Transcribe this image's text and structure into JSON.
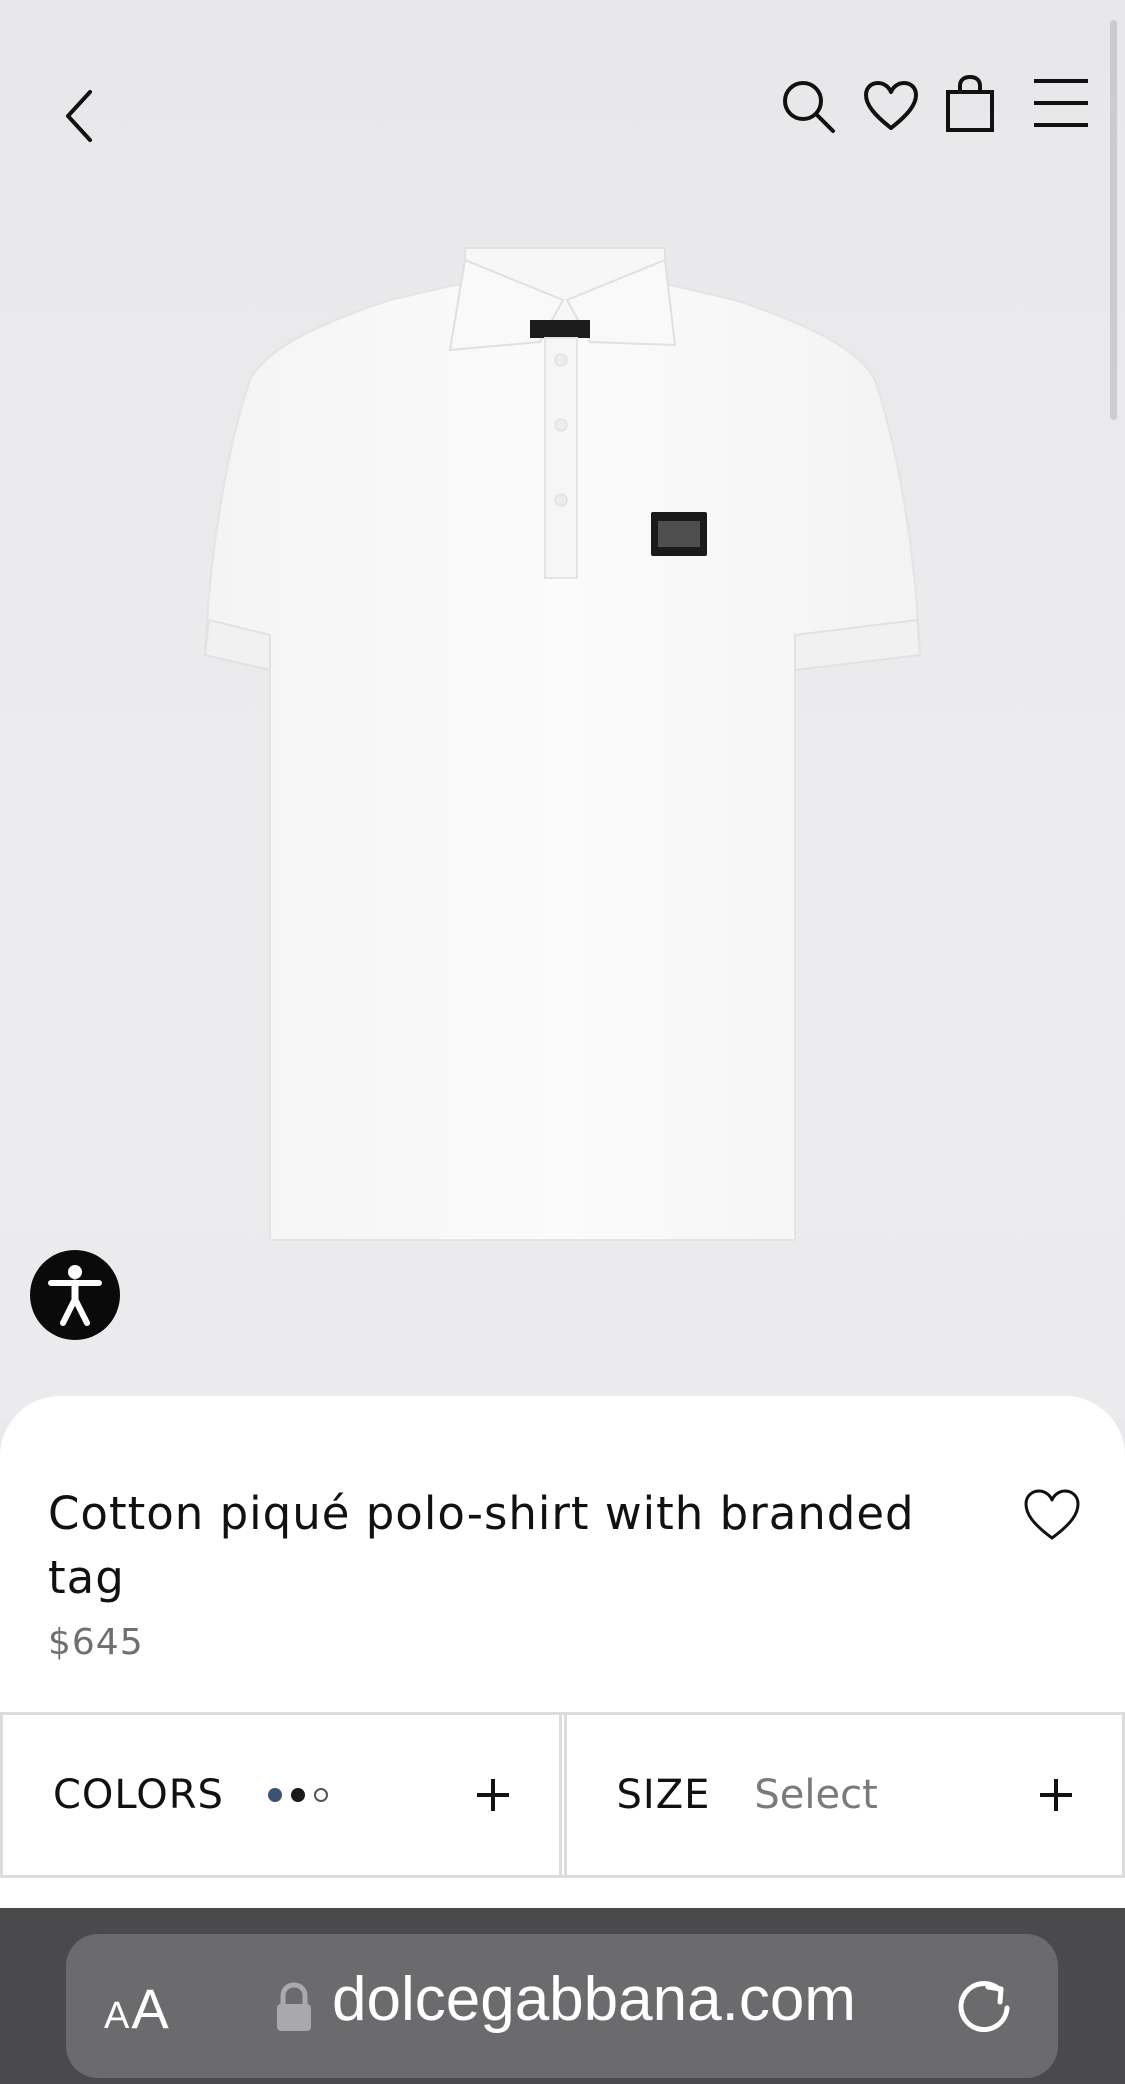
{
  "header": {
    "icons": [
      "chevron-left-icon",
      "search-icon",
      "heart-icon",
      "shopping-bag-icon",
      "hamburger-menu-icon"
    ]
  },
  "accessibility": {
    "icon": "accessibility-icon",
    "background": "#0a0a0a"
  },
  "product": {
    "title": "Cotton piqué polo-shirt with branded tag",
    "price": "$645",
    "image_icon": "white-polo-shirt-image",
    "wishlist_icon": "heart-outline-icon"
  },
  "options": {
    "colors": {
      "label": "COLORS",
      "swatches": [
        "#3b5275",
        "#1a1a1a",
        "#ffffff"
      ]
    },
    "size": {
      "label": "SIZE",
      "value": "Select"
    }
  },
  "browser": {
    "aa_small": "A",
    "aa_big": "A",
    "url": "dolcegabbana.com",
    "icons": [
      "lock-icon",
      "reload-icon"
    ]
  },
  "colors": {
    "hero_bg": "#e9e9eb",
    "sheet_bg": "#ffffff",
    "price_text": "#6f6f6f",
    "browser_bar": "#4a4a4c",
    "url_pill": "#6b6b6e"
  }
}
